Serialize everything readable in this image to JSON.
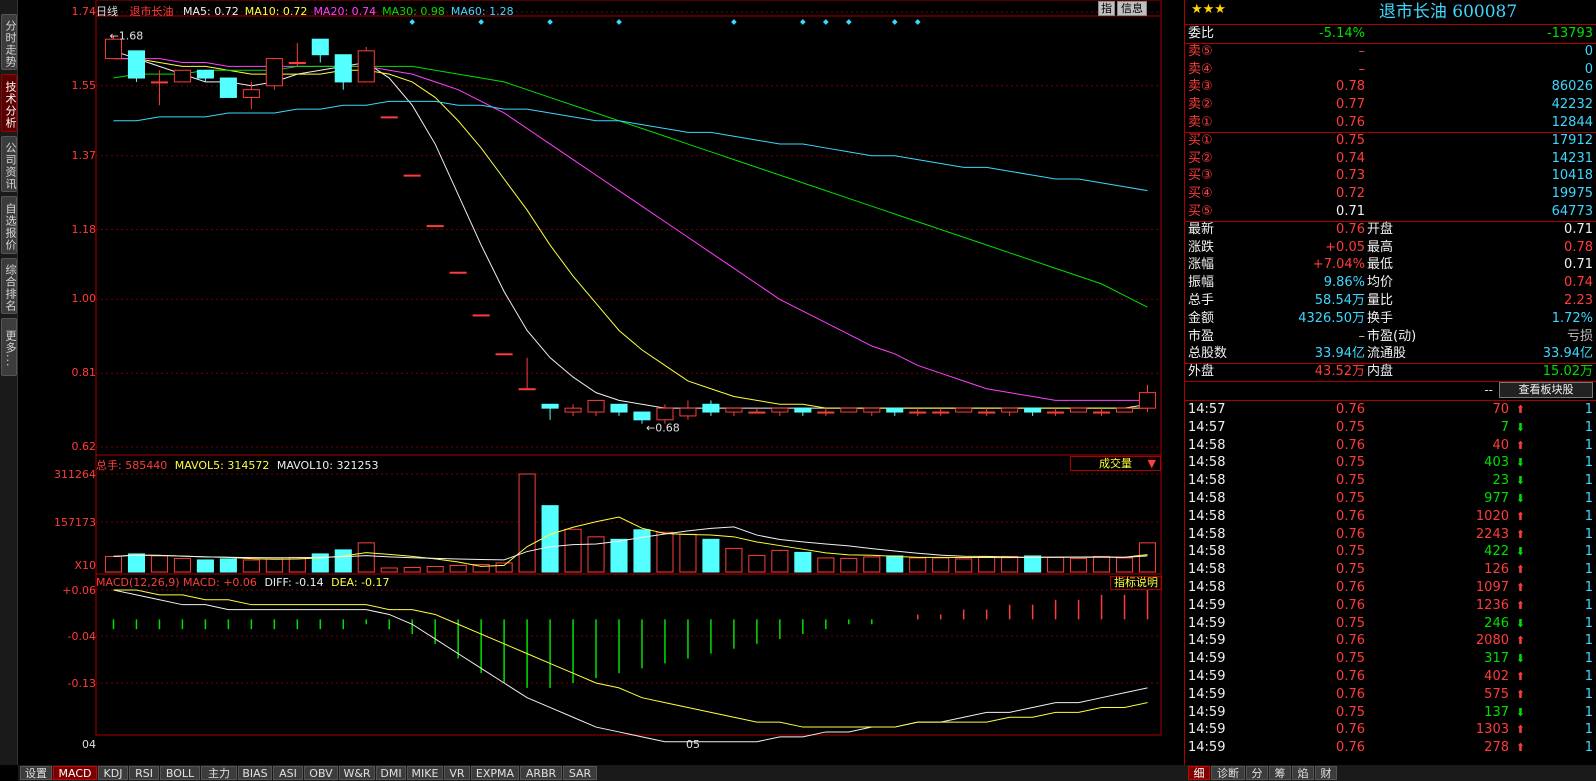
{
  "left_tabs": [
    "分时走势",
    "技术分析",
    "公司资讯",
    "自选报价",
    "综合排名",
    "更多..."
  ],
  "left_active": 1,
  "chart": {
    "period": "日线",
    "stock_name": "退市长油",
    "ma": [
      {
        "label": "MA5: 0.72",
        "color": "#f0f0f0"
      },
      {
        "label": "MA10: 0.72",
        "color": "#ffff3c"
      },
      {
        "label": "MA20: 0.74",
        "color": "#ff40ff"
      },
      {
        "label": "MA30: 0.98",
        "color": "#00e000"
      },
      {
        "label": "MA60: 1.28",
        "color": "#3cd8ff"
      }
    ],
    "buttons": {
      "zhi": "指",
      "info": "信息"
    },
    "y_ticks": [
      "1.74",
      "1.55",
      "1.37",
      "1.18",
      "1.00",
      "0.81",
      "0.62"
    ],
    "high_label": "1.68",
    "low_label": "0.68",
    "volume": {
      "header": "总手: 585440",
      "mavol5": "MAVOL5: 314572",
      "mavol10": "MAVOL10: 321253",
      "selector": "成交量",
      "y_ticks": [
        "311264",
        "157173",
        "X10"
      ]
    },
    "macd": {
      "header": "MACD(12,26,9) MACD: +0.06",
      "diff": "DIFF: -0.14",
      "dea": "DEA: -0.17",
      "help": "指标说明",
      "y_ticks": [
        "+0.06",
        "-0.04",
        "-0.13"
      ]
    },
    "x_labels": [
      "04",
      "05"
    ],
    "candles": [
      [
        1.62,
        1.67,
        1.68,
        1.62
      ],
      [
        1.64,
        1.57,
        1.64,
        1.56
      ],
      [
        1.56,
        1.56,
        1.59,
        1.5
      ],
      [
        1.56,
        1.59,
        1.59,
        1.56
      ],
      [
        1.59,
        1.57,
        1.59,
        1.56
      ],
      [
        1.57,
        1.52,
        1.57,
        1.52
      ],
      [
        1.52,
        1.54,
        1.56,
        1.49
      ],
      [
        1.55,
        1.62,
        1.62,
        1.54
      ],
      [
        1.61,
        1.61,
        1.66,
        1.6
      ],
      [
        1.67,
        1.63,
        1.67,
        1.61
      ],
      [
        1.63,
        1.56,
        1.63,
        1.54
      ],
      [
        1.56,
        1.64,
        1.65,
        1.56
      ],
      [
        1.47,
        1.47,
        1.47,
        1.47
      ],
      [
        1.32,
        1.32,
        1.32,
        1.32
      ],
      [
        1.19,
        1.19,
        1.19,
        1.19
      ],
      [
        1.07,
        1.07,
        1.07,
        1.07
      ],
      [
        0.96,
        0.96,
        0.96,
        0.96
      ],
      [
        0.86,
        0.86,
        0.86,
        0.86
      ],
      [
        0.77,
        0.77,
        0.85,
        0.77
      ],
      [
        0.73,
        0.72,
        0.73,
        0.69
      ],
      [
        0.71,
        0.72,
        0.73,
        0.7
      ],
      [
        0.71,
        0.74,
        0.74,
        0.7
      ],
      [
        0.73,
        0.71,
        0.73,
        0.7
      ],
      [
        0.71,
        0.69,
        0.71,
        0.68
      ],
      [
        0.69,
        0.72,
        0.73,
        0.68
      ],
      [
        0.7,
        0.72,
        0.74,
        0.69
      ],
      [
        0.73,
        0.71,
        0.74,
        0.7
      ],
      [
        0.71,
        0.72,
        0.72,
        0.7
      ],
      [
        0.71,
        0.71,
        0.72,
        0.71
      ],
      [
        0.71,
        0.72,
        0.72,
        0.7
      ],
      [
        0.72,
        0.71,
        0.72,
        0.7
      ],
      [
        0.71,
        0.71,
        0.72,
        0.7
      ],
      [
        0.71,
        0.72,
        0.72,
        0.71
      ],
      [
        0.71,
        0.72,
        0.72,
        0.7
      ],
      [
        0.72,
        0.71,
        0.72,
        0.7
      ],
      [
        0.71,
        0.71,
        0.72,
        0.7
      ],
      [
        0.71,
        0.71,
        0.72,
        0.7
      ],
      [
        0.71,
        0.72,
        0.72,
        0.71
      ],
      [
        0.71,
        0.71,
        0.72,
        0.7
      ],
      [
        0.71,
        0.72,
        0.72,
        0.7
      ],
      [
        0.72,
        0.71,
        0.72,
        0.7
      ],
      [
        0.71,
        0.71,
        0.72,
        0.7
      ],
      [
        0.71,
        0.72,
        0.72,
        0.71
      ],
      [
        0.71,
        0.71,
        0.72,
        0.7
      ],
      [
        0.71,
        0.72,
        0.72,
        0.71
      ],
      [
        0.72,
        0.76,
        0.78,
        0.71
      ]
    ],
    "volumes": [
      31,
      36,
      32,
      27,
      24,
      26,
      24,
      26,
      29,
      36,
      44,
      58,
      8,
      9,
      11,
      13,
      15,
      18,
      195,
      132,
      85,
      70,
      65,
      84,
      79,
      75,
      65,
      47,
      33,
      43,
      39,
      28,
      27,
      30,
      32,
      28,
      28,
      26,
      30,
      31,
      32,
      29,
      27,
      31,
      28,
      58
    ],
    "ma_lines": {
      "ma5": [
        1.64,
        1.62,
        1.6,
        1.58,
        1.56,
        1.56,
        1.55,
        1.56,
        1.58,
        1.59,
        1.6,
        1.61,
        1.57,
        1.5,
        1.4,
        1.27,
        1.14,
        1.02,
        0.92,
        0.85,
        0.8,
        0.76,
        0.74,
        0.73,
        0.72,
        0.72,
        0.72,
        0.72,
        0.72,
        0.72,
        0.72,
        0.72,
        0.72,
        0.72,
        0.72,
        0.72,
        0.72,
        0.72,
        0.72,
        0.72,
        0.72,
        0.72,
        0.72,
        0.72,
        0.72,
        0.73
      ],
      "ma10": [
        1.62,
        1.62,
        1.61,
        1.6,
        1.6,
        1.59,
        1.58,
        1.58,
        1.58,
        1.58,
        1.59,
        1.59,
        1.58,
        1.56,
        1.52,
        1.46,
        1.39,
        1.31,
        1.23,
        1.14,
        1.06,
        0.99,
        0.92,
        0.87,
        0.83,
        0.79,
        0.77,
        0.75,
        0.74,
        0.73,
        0.73,
        0.72,
        0.72,
        0.72,
        0.72,
        0.72,
        0.72,
        0.72,
        0.72,
        0.72,
        0.72,
        0.72,
        0.72,
        0.72,
        0.72,
        0.72
      ],
      "ma20": [
        1.62,
        1.62,
        1.62,
        1.61,
        1.61,
        1.6,
        1.6,
        1.6,
        1.6,
        1.6,
        1.6,
        1.6,
        1.59,
        1.58,
        1.56,
        1.54,
        1.51,
        1.48,
        1.44,
        1.4,
        1.36,
        1.32,
        1.28,
        1.24,
        1.2,
        1.16,
        1.12,
        1.08,
        1.04,
        1.0,
        0.97,
        0.94,
        0.91,
        0.88,
        0.86,
        0.83,
        0.81,
        0.79,
        0.77,
        0.76,
        0.75,
        0.74,
        0.74,
        0.74,
        0.74,
        0.74
      ],
      "ma30": [
        1.57,
        1.58,
        1.58,
        1.58,
        1.59,
        1.59,
        1.59,
        1.59,
        1.6,
        1.6,
        1.6,
        1.6,
        1.6,
        1.6,
        1.59,
        1.58,
        1.57,
        1.56,
        1.54,
        1.52,
        1.5,
        1.48,
        1.46,
        1.44,
        1.42,
        1.4,
        1.38,
        1.36,
        1.34,
        1.32,
        1.3,
        1.28,
        1.26,
        1.24,
        1.22,
        1.2,
        1.18,
        1.16,
        1.14,
        1.12,
        1.1,
        1.08,
        1.06,
        1.04,
        1.01,
        0.98
      ],
      "ma60": [
        1.46,
        1.46,
        1.47,
        1.47,
        1.47,
        1.48,
        1.48,
        1.48,
        1.49,
        1.49,
        1.5,
        1.5,
        1.51,
        1.51,
        1.51,
        1.5,
        1.5,
        1.49,
        1.49,
        1.48,
        1.47,
        1.46,
        1.46,
        1.45,
        1.44,
        1.43,
        1.43,
        1.42,
        1.41,
        1.4,
        1.4,
        1.39,
        1.38,
        1.37,
        1.37,
        1.36,
        1.35,
        1.34,
        1.34,
        1.33,
        1.32,
        1.31,
        1.31,
        1.3,
        1.29,
        1.28
      ]
    },
    "macd_hist": [
      -0.02,
      -0.02,
      -0.02,
      -0.02,
      -0.02,
      -0.02,
      -0.02,
      -0.02,
      -0.02,
      -0.02,
      -0.02,
      -0.01,
      -0.02,
      -0.03,
      -0.05,
      -0.08,
      -0.11,
      -0.13,
      -0.14,
      -0.14,
      -0.13,
      -0.12,
      -0.11,
      -0.1,
      -0.09,
      -0.08,
      -0.07,
      -0.06,
      -0.05,
      -0.04,
      -0.03,
      -0.02,
      -0.01,
      -0.01,
      0.0,
      0.01,
      0.01,
      0.02,
      0.02,
      0.03,
      0.03,
      0.04,
      0.04,
      0.05,
      0.05,
      0.06
    ],
    "macd_diff": [
      0.06,
      0.05,
      0.04,
      0.03,
      0.03,
      0.02,
      0.02,
      0.02,
      0.02,
      0.02,
      0.02,
      0.02,
      0.01,
      -0.01,
      -0.04,
      -0.07,
      -0.1,
      -0.13,
      -0.16,
      -0.18,
      -0.2,
      -0.22,
      -0.23,
      -0.24,
      -0.25,
      -0.25,
      -0.25,
      -0.25,
      -0.25,
      -0.24,
      -0.24,
      -0.23,
      -0.23,
      -0.22,
      -0.22,
      -0.21,
      -0.21,
      -0.2,
      -0.19,
      -0.19,
      -0.18,
      -0.17,
      -0.17,
      -0.16,
      -0.15,
      -0.14
    ],
    "macd_dea": [
      0.06,
      0.06,
      0.05,
      0.05,
      0.04,
      0.04,
      0.03,
      0.03,
      0.03,
      0.03,
      0.03,
      0.03,
      0.02,
      0.02,
      0.01,
      -0.01,
      -0.03,
      -0.05,
      -0.07,
      -0.09,
      -0.11,
      -0.13,
      -0.14,
      -0.16,
      -0.17,
      -0.18,
      -0.19,
      -0.2,
      -0.21,
      -0.21,
      -0.22,
      -0.22,
      -0.22,
      -0.22,
      -0.22,
      -0.21,
      -0.21,
      -0.21,
      -0.21,
      -0.2,
      -0.2,
      -0.19,
      -0.19,
      -0.18,
      -0.18,
      -0.17
    ]
  },
  "panel": {
    "stars": "★★★",
    "title": "退市长油 600087",
    "weibi": {
      "label": "委比",
      "pct": "-5.14%",
      "val": "-13793"
    },
    "sell": [
      {
        "label": "卖⑤",
        "price": "–",
        "vol": "0"
      },
      {
        "label": "卖④",
        "price": "–",
        "vol": "0"
      },
      {
        "label": "卖③",
        "price": "0.78",
        "vol": "86026"
      },
      {
        "label": "卖②",
        "price": "0.77",
        "vol": "42232"
      },
      {
        "label": "卖①",
        "price": "0.76",
        "vol": "12844"
      }
    ],
    "buy": [
      {
        "label": "买①",
        "price": "0.75",
        "vol": "17912"
      },
      {
        "label": "买②",
        "price": "0.74",
        "vol": "14231"
      },
      {
        "label": "买③",
        "price": "0.73",
        "vol": "10418"
      },
      {
        "label": "买④",
        "price": "0.72",
        "vol": "19975"
      },
      {
        "label": "买⑤",
        "price": "0.71",
        "vol": "64773"
      }
    ],
    "stats": [
      {
        "l1": "最新",
        "v1": "0.76",
        "c1": "red",
        "l2": "开盘",
        "v2": "0.71",
        "c2": "white"
      },
      {
        "l1": "涨跌",
        "v1": "+0.05",
        "c1": "red",
        "l2": "最高",
        "v2": "0.78",
        "c2": "red"
      },
      {
        "l1": "涨幅",
        "v1": "+7.04%",
        "c1": "red",
        "l2": "最低",
        "v2": "0.71",
        "c2": "white"
      },
      {
        "l1": "振幅",
        "v1": "9.86%",
        "c1": "cyan",
        "l2": "均价",
        "v2": "0.74",
        "c2": "red"
      },
      {
        "l1": "总手",
        "v1": "58.54万",
        "c1": "cyan",
        "l2": "量比",
        "v2": "2.23",
        "c2": "red"
      },
      {
        "l1": "金额",
        "v1": "4326.50万",
        "c1": "cyan",
        "l2": "换手",
        "v2": "1.72%",
        "c2": "cyan"
      },
      {
        "l1": "市盈",
        "v1": "–",
        "c1": "gray",
        "l2": "市盈(动)",
        "v2": "亏损",
        "c2": "gray"
      },
      {
        "l1": "总股数",
        "v1": "33.94亿",
        "c1": "cyan",
        "l2": "流通股",
        "v2": "33.94亿",
        "c2": "cyan"
      }
    ],
    "waipan": {
      "l1": "外盘",
      "v1": "43.52万",
      "l2": "内盘",
      "v2": "15.02万"
    },
    "dash": "--",
    "sector_btn": "查看板块股",
    "ticks": [
      {
        "t": "14:57",
        "p": "0.76",
        "v": "70",
        "d": "up",
        "n": "1"
      },
      {
        "t": "14:57",
        "p": "0.75",
        "v": "7",
        "d": "down",
        "n": "1"
      },
      {
        "t": "14:58",
        "p": "0.76",
        "v": "40",
        "d": "up",
        "n": "1"
      },
      {
        "t": "14:58",
        "p": "0.75",
        "v": "403",
        "d": "down",
        "n": "1"
      },
      {
        "t": "14:58",
        "p": "0.75",
        "v": "23",
        "d": "down",
        "n": "1"
      },
      {
        "t": "14:58",
        "p": "0.75",
        "v": "977",
        "d": "down",
        "n": "1"
      },
      {
        "t": "14:58",
        "p": "0.76",
        "v": "1020",
        "d": "up",
        "n": "1"
      },
      {
        "t": "14:58",
        "p": "0.76",
        "v": "2243",
        "d": "up",
        "n": "1"
      },
      {
        "t": "14:58",
        "p": "0.75",
        "v": "422",
        "d": "down",
        "n": "1"
      },
      {
        "t": "14:58",
        "p": "0.75",
        "v": "126",
        "d": "up",
        "n": "1"
      },
      {
        "t": "14:58",
        "p": "0.76",
        "v": "1097",
        "d": "up",
        "n": "1"
      },
      {
        "t": "14:59",
        "p": "0.76",
        "v": "1236",
        "d": "up",
        "n": "1"
      },
      {
        "t": "14:59",
        "p": "0.75",
        "v": "246",
        "d": "down",
        "n": "1"
      },
      {
        "t": "14:59",
        "p": "0.76",
        "v": "2080",
        "d": "up",
        "n": "1"
      },
      {
        "t": "14:59",
        "p": "0.75",
        "v": "317",
        "d": "down",
        "n": "1"
      },
      {
        "t": "14:59",
        "p": "0.76",
        "v": "402",
        "d": "up",
        "n": "1"
      },
      {
        "t": "14:59",
        "p": "0.76",
        "v": "575",
        "d": "up",
        "n": "1"
      },
      {
        "t": "14:59",
        "p": "0.75",
        "v": "137",
        "d": "down",
        "n": "1"
      },
      {
        "t": "14:59",
        "p": "0.76",
        "v": "1303",
        "d": "up",
        "n": "1"
      },
      {
        "t": "14:59",
        "p": "0.76",
        "v": "278",
        "d": "up",
        "n": "1"
      }
    ]
  },
  "bottom_tabs": [
    "设置",
    "MACD",
    "KDJ",
    "RSI",
    "BOLL",
    "主力",
    "BIAS",
    "ASI",
    "OBV",
    "W&R",
    "DMI",
    "MIKE",
    "VR",
    "EXPMA",
    "ARBR",
    "SAR"
  ],
  "bottom_active": 1,
  "panel_tabs": [
    "细",
    "诊断",
    "分",
    "筹",
    "焰",
    "财"
  ],
  "panel_active": 0
}
